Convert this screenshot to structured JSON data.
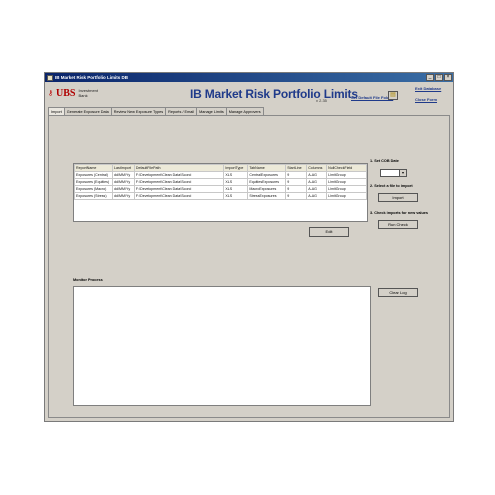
{
  "window": {
    "title": "IB Market Risk Portfolio Limits DB",
    "controls": [
      "_",
      "□",
      "×"
    ]
  },
  "header": {
    "logo_text": "UBS",
    "bank_line1": "Investment",
    "bank_line2": "Bank",
    "app_title": "IB Market Risk Portfolio Limits",
    "version": "v 2.35",
    "default_folder_link": "Set Default File Folder",
    "exit_link": "Exit Database",
    "close_link": "Close Form"
  },
  "tabs": [
    {
      "label": "Import"
    },
    {
      "label": "Generate Exposure Data"
    },
    {
      "label": "Review New Exposure Types"
    },
    {
      "label": "Reports / Email"
    },
    {
      "label": "Manage Limits"
    },
    {
      "label": "Manage Approvers"
    }
  ],
  "grid": {
    "columns": [
      "ReportName",
      "LastImport",
      "DefaultFilePath",
      "ImportType",
      "TabName",
      "StartLine",
      "Columns",
      "NullCheckField"
    ],
    "rows": [
      [
        "Exposures (Central)",
        "dd/MM/Yy",
        "F:\\Development\\Clean Data\\Scorci",
        "XLS",
        "CentralExposures",
        "9",
        "A-AG",
        "LimitGroup"
      ],
      [
        "Exposures (Equities)",
        "dd/MM/Yy",
        "F:\\Development\\Clean Data\\Scorci",
        "XLS",
        "EquitiesExposures",
        "9",
        "A-AG",
        "LimitGroup"
      ],
      [
        "Exposures (Macro)",
        "dd/MM/Yy",
        "F:\\Development\\Clean Data\\Scorci",
        "XLS",
        "MacroExposures",
        "9",
        "A-AG",
        "LimitGroup"
      ],
      [
        "Exposures (Stress)",
        "dd/MM/Yy",
        "F:\\Development\\Clean Data\\Scorci",
        "XLS",
        "StressExposures",
        "9",
        "A-AG",
        "LimitGroup"
      ]
    ]
  },
  "buttons": {
    "edit": "Edit",
    "import": "Import",
    "run_check": "Run Check",
    "clear_log": "Clear Log"
  },
  "steps": {
    "step1": "1. Set COB Date",
    "step2": "2. Select a file to import",
    "step3": "3. Check imports for new values"
  },
  "cob_value": "",
  "monitor_label": "Monitor Process"
}
